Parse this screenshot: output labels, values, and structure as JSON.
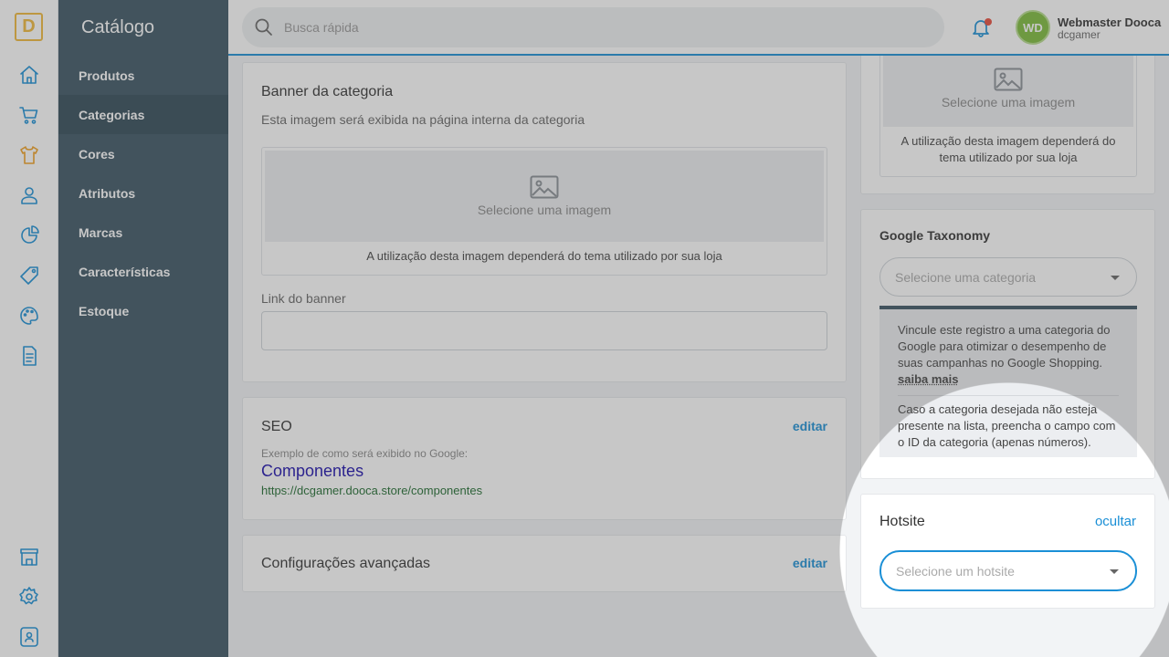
{
  "app": {
    "logo_letter": "D"
  },
  "rail_icons": [
    "home-icon",
    "cart-icon",
    "shirt-icon",
    "customer-icon",
    "chart-icon",
    "tag-icon",
    "palette-icon",
    "document-icon",
    "store-icon",
    "gear-icon",
    "lock-icon"
  ],
  "sidebar": {
    "title": "Catálogo",
    "items": [
      {
        "label": "Produtos"
      },
      {
        "label": "Categorias"
      },
      {
        "label": "Cores"
      },
      {
        "label": "Atributos"
      },
      {
        "label": "Marcas"
      },
      {
        "label": "Características"
      },
      {
        "label": "Estoque"
      }
    ],
    "active_item": "Categorias"
  },
  "topbar": {
    "search_placeholder": "Busca rápida",
    "user": {
      "initials": "WD",
      "name": "Webmaster Dooca",
      "store": "dcgamer"
    }
  },
  "banner": {
    "title": "Banner da categoria",
    "subtitle": "Esta imagem será exibida na página interna da categoria",
    "image_label": "Selecione uma imagem",
    "image_note": "A utilização desta imagem dependerá do tema utilizado por sua loja",
    "link_label": "Link do banner",
    "link_value": ""
  },
  "seo": {
    "title": "SEO",
    "edit_label": "editar",
    "example_label": "Exemplo de como será exibido no Google:",
    "preview_title": "Componentes",
    "preview_url": "https://dcgamer.dooca.store/componentes"
  },
  "advanced": {
    "title": "Configurações avançadas",
    "edit_label": "editar"
  },
  "side_image": {
    "image_label": "Selecione uma imagem",
    "image_note": "A utilização desta imagem dependerá do tema utilizado por sua loja"
  },
  "google_taxonomy": {
    "title": "Google Taxonomy",
    "select_placeholder": "Selecione uma categoria",
    "info_text": "Vincule este registro a uma categoria do Google para otimizar o desempenho de suas campanhas no Google Shopping.",
    "learn_more": "saiba mais",
    "info_text_2": "Caso a categoria desejada não esteja presente na lista, preencha o campo com o ID da categoria (apenas números)."
  },
  "hotsite": {
    "title": "Hotsite",
    "hide_label": "ocultar",
    "select_placeholder": "Selecione um hotsite"
  },
  "colors": {
    "accent": "#1a8fd6",
    "sidebar": "#3b5563",
    "logo": "#f0b83a"
  }
}
